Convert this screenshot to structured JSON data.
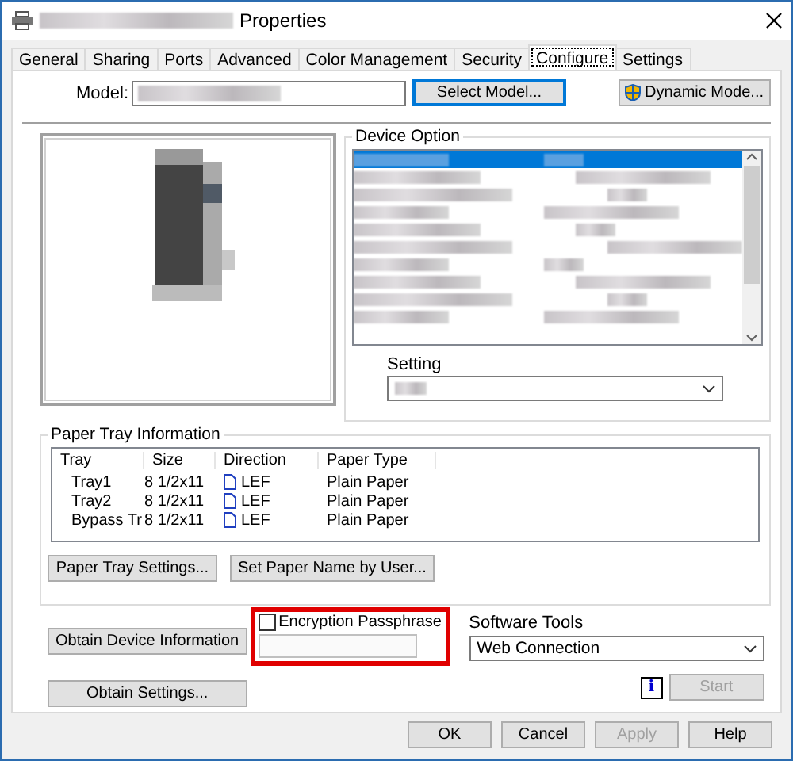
{
  "window": {
    "title": "Properties"
  },
  "tabs": [
    {
      "label": "General",
      "selected": false
    },
    {
      "label": "Sharing",
      "selected": false
    },
    {
      "label": "Ports",
      "selected": false
    },
    {
      "label": "Advanced",
      "selected": false
    },
    {
      "label": "Color Management",
      "selected": false
    },
    {
      "label": "Security",
      "selected": false
    },
    {
      "label": "Configure",
      "selected": true
    },
    {
      "label": "Settings",
      "selected": false
    }
  ],
  "model": {
    "label": "Model:",
    "select_button": "Select Model...",
    "dynamic_button": "Dynamic Mode..."
  },
  "device_option": {
    "title": "Device Option",
    "rows": [
      {
        "selected": true
      },
      {
        "selected": false
      },
      {
        "selected": false
      },
      {
        "selected": false
      },
      {
        "selected": false
      },
      {
        "selected": false
      },
      {
        "selected": false
      },
      {
        "selected": false
      },
      {
        "selected": false
      },
      {
        "selected": false
      }
    ],
    "setting_label": "Setting"
  },
  "paper_tray": {
    "title": "Paper Tray Information",
    "columns": [
      "Tray",
      "Size",
      "Direction",
      "Paper Type"
    ],
    "rows": [
      {
        "tray": "Tray1",
        "size": "8 1/2x11",
        "direction": "LEF",
        "paper_type": "Plain Paper"
      },
      {
        "tray": "Tray2",
        "size": "8 1/2x11",
        "direction": "LEF",
        "paper_type": "Plain Paper"
      },
      {
        "tray": "Bypass Tr",
        "size": "8 1/2x11",
        "direction": "LEF",
        "paper_type": "Plain Paper"
      }
    ],
    "buttons": [
      "Paper Tray Settings...",
      "Set Paper Name by User..."
    ]
  },
  "obtain_device_button": "Obtain Device Information",
  "obtain_settings_button": "Obtain Settings...",
  "encryption": {
    "label": "Encryption Passphrase",
    "checked": false
  },
  "software_tools": {
    "label": "Software Tools",
    "info_icon": "i",
    "value": "Web Connection",
    "start_button": {
      "label": "Start",
      "disabled": true
    }
  },
  "footer_buttons": [
    {
      "label": "OK",
      "disabled": false
    },
    {
      "label": "Cancel",
      "disabled": false
    },
    {
      "label": "Apply",
      "disabled": true
    },
    {
      "label": "Help",
      "disabled": false
    }
  ]
}
